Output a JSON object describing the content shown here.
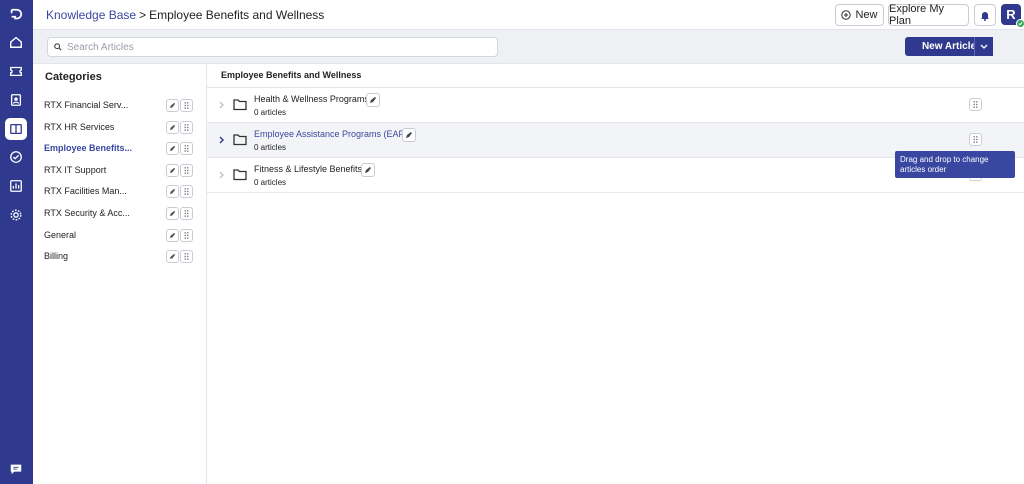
{
  "header": {
    "breadcrumb_root": "Knowledge Base",
    "breadcrumb_sep": ">",
    "breadcrumb_current": "Employee Benefits and Wellness",
    "new_label": "New",
    "explore_label": "Explore My Plan",
    "avatar_initial": "R"
  },
  "search": {
    "placeholder": "Search Articles"
  },
  "actions": {
    "new_article_label": "New Article"
  },
  "sidebar": {
    "title": "Categories",
    "items": [
      {
        "label": "RTX Financial Serv..."
      },
      {
        "label": "RTX HR Services"
      },
      {
        "label": "Employee Benefits..."
      },
      {
        "label": "RTX IT Support"
      },
      {
        "label": "RTX Facilities Man..."
      },
      {
        "label": "RTX Security & Acc..."
      },
      {
        "label": "General"
      },
      {
        "label": "Billing"
      }
    ],
    "active_index": 2
  },
  "main": {
    "title": "Employee Benefits and Wellness",
    "folders": [
      {
        "name": "Health & Wellness Programs",
        "count": "0 articles"
      },
      {
        "name": "Employee Assistance Programs (EAP)",
        "count": "0 articles"
      },
      {
        "name": "Fitness & Lifestyle Benefits",
        "count": "0 articles"
      }
    ]
  },
  "tooltip": {
    "text": "Drag and drop to change articles order"
  },
  "colors": {
    "brand": "#2f3a8f",
    "link": "#3a47a0",
    "status_online": "#2ea84f"
  },
  "icons": [
    "logo-icon",
    "home-icon",
    "ticket-icon",
    "contacts-icon",
    "knowledge-base-icon",
    "tasks-icon",
    "reports-icon",
    "settings-icon",
    "chat-icon",
    "plus-circle-icon",
    "bell-icon",
    "search-icon",
    "chevron-down-icon",
    "edit-icon",
    "drag-handle-icon",
    "folder-icon",
    "chevron-right-icon"
  ]
}
